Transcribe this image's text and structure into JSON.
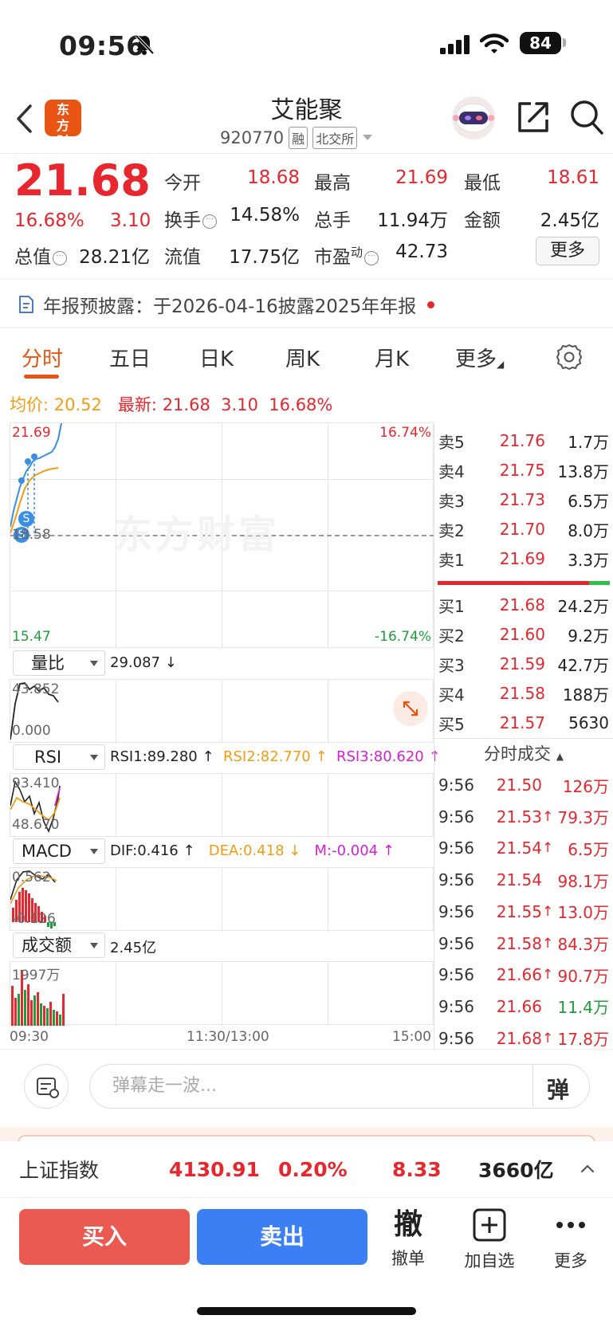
{
  "status_bar": {
    "time": "09:56",
    "battery": "84"
  },
  "header": {
    "logo_text": "东方财富",
    "stock_name": "艾能聚",
    "stock_code": "920770",
    "tags": [
      "融",
      "北交所"
    ]
  },
  "quote": {
    "price": "21.68",
    "change_pct": "16.68%",
    "change": "3.10",
    "fields": {
      "open_label": "今开",
      "open": "18.68",
      "high_label": "最高",
      "high": "21.69",
      "low_label": "最低",
      "low": "18.61",
      "turnover_label": "换手",
      "turnover": "14.58%",
      "volume_label": "总手",
      "volume": "11.94万",
      "amount_label": "金额",
      "amount": "2.45亿",
      "mktcap_label": "总值",
      "mktcap": "28.21亿",
      "float_label": "流值",
      "float": "17.75亿",
      "pe_label": "市盈",
      "pe_sup": "动",
      "pe": "42.73"
    },
    "more_label": "更多"
  },
  "notice": {
    "text": "年报预披露：于2026-04-16披露2025年年报"
  },
  "tabs": [
    "分时",
    "五日",
    "日K",
    "周K",
    "月K",
    "更多"
  ],
  "avg_line": {
    "avg_label": "均价:",
    "avg": "20.52",
    "latest_label": "最新:",
    "latest": "21.68",
    "change": "3.10",
    "pct": "16.68%"
  },
  "main_chart": {
    "y_top": "21.69",
    "y_mid": "18.58",
    "y_bot": "15.47",
    "pct_top": "16.74%",
    "pct_bot": "-16.74%",
    "watermark": "东方财富"
  },
  "indicators": {
    "vol_ratio": {
      "name": "量比",
      "value": "29.087 ↓",
      "max": "43.852",
      "min": "0.000"
    },
    "rsi": {
      "name": "RSI",
      "rsi1": "RSI1:89.280 ↑",
      "rsi2": "RSI2:82.770 ↑",
      "rsi3": "RSI3:80.620 ↑",
      "max": "93.410",
      "min": "48.670"
    },
    "macd": {
      "name": "MACD",
      "dif": "DIF:0.416 ↑",
      "dea": "DEA:0.418 ↓",
      "m": "M:-0.004 ↑",
      "max": "0.562",
      "min": "-0.126"
    },
    "amount": {
      "name": "成交额",
      "value": "2.45亿",
      "max": "1997万"
    }
  },
  "time_axis": {
    "start": "09:30",
    "mid": "11:30/13:00",
    "end": "15:00"
  },
  "order_book": {
    "sell": [
      {
        "label": "卖5",
        "price": "21.76",
        "vol": "1.7万"
      },
      {
        "label": "卖4",
        "price": "21.75",
        "vol": "13.8万"
      },
      {
        "label": "卖3",
        "price": "21.73",
        "vol": "6.5万"
      },
      {
        "label": "卖2",
        "price": "21.70",
        "vol": "8.0万"
      },
      {
        "label": "卖1",
        "price": "21.69",
        "vol": "3.3万"
      }
    ],
    "buy": [
      {
        "label": "买1",
        "price": "21.68",
        "vol": "24.2万"
      },
      {
        "label": "买2",
        "price": "21.60",
        "vol": "9.2万"
      },
      {
        "label": "买3",
        "price": "21.59",
        "vol": "42.7万"
      },
      {
        "label": "买4",
        "price": "21.58",
        "vol": "188万"
      },
      {
        "label": "买5",
        "price": "21.57",
        "vol": "5630"
      }
    ]
  },
  "ticks": {
    "title": "分时成交",
    "rows": [
      {
        "time": "9:56",
        "price": "21.50",
        "arrow": "",
        "vol": "126万",
        "dir": "red"
      },
      {
        "time": "9:56",
        "price": "21.53",
        "arrow": "↑",
        "vol": "79.3万",
        "dir": "red"
      },
      {
        "time": "9:56",
        "price": "21.54",
        "arrow": "↑",
        "vol": "6.5万",
        "dir": "red"
      },
      {
        "time": "9:56",
        "price": "21.54",
        "arrow": "",
        "vol": "98.1万",
        "dir": "red"
      },
      {
        "time": "9:56",
        "price": "21.55",
        "arrow": "↑",
        "vol": "13.0万",
        "dir": "red"
      },
      {
        "time": "9:56",
        "price": "21.58",
        "arrow": "↑",
        "vol": "84.3万",
        "dir": "red"
      },
      {
        "time": "9:56",
        "price": "21.66",
        "arrow": "↑",
        "vol": "90.7万",
        "dir": "red"
      },
      {
        "time": "9:56",
        "price": "21.66",
        "arrow": "",
        "vol": "11.4万",
        "dir": "green"
      },
      {
        "time": "9:56",
        "price": "21.68",
        "arrow": "↑",
        "vol": "17.8万",
        "dir": "red"
      }
    ]
  },
  "danmu": {
    "placeholder": "弹幕走一波...",
    "button": "弹"
  },
  "index_bar": {
    "name": "上证指数",
    "value": "4130.91",
    "pct": "0.20%",
    "change": "8.33",
    "amount": "3660亿"
  },
  "actions": {
    "buy": "买入",
    "sell": "卖出",
    "cancel_glyph": "撤",
    "cancel": "撤单",
    "watch": "加自选",
    "more": "更多"
  },
  "colors": {
    "up": "#e8262d",
    "down": "#1e9e3a",
    "brand": "#ea5413",
    "buy": "#eb5a50",
    "sell": "#3b7ff5"
  }
}
